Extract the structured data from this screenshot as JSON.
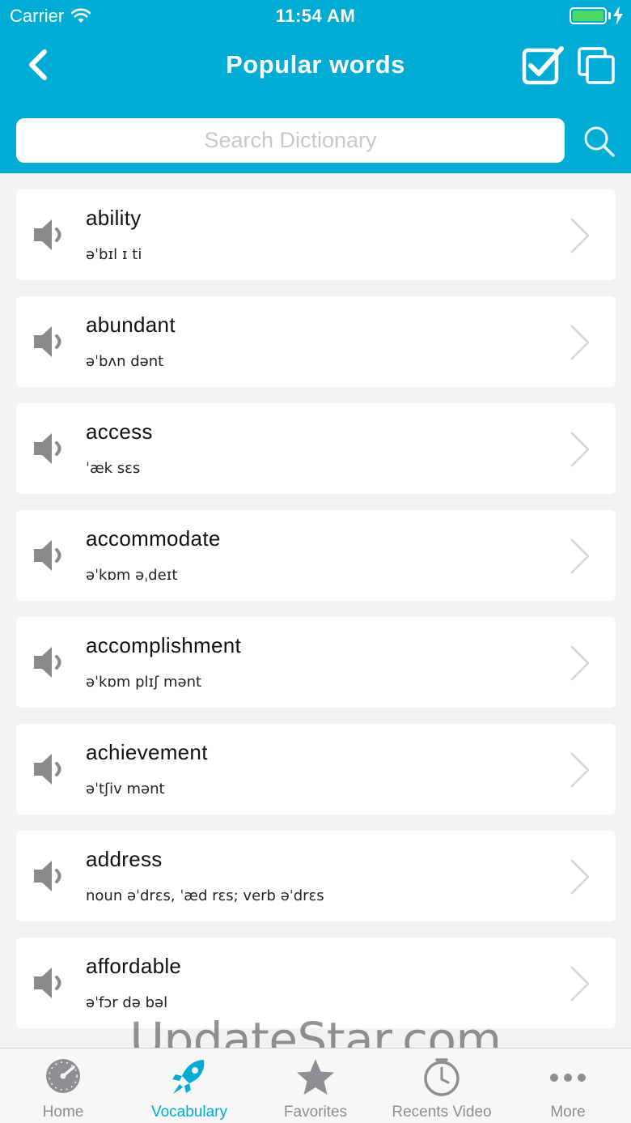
{
  "status_bar": {
    "carrier": "Carrier",
    "time": "11:54 AM"
  },
  "nav": {
    "title": "Popular words"
  },
  "search": {
    "placeholder": "Search Dictionary"
  },
  "words": [
    {
      "word": "ability",
      "phonetic": "əˈbɪl ɪ ti"
    },
    {
      "word": "abundant",
      "phonetic": "əˈbʌn dənt"
    },
    {
      "word": "access",
      "phonetic": "ˈæk sɛs"
    },
    {
      "word": "accommodate",
      "phonetic": "əˈkɒm əˌdeɪt"
    },
    {
      "word": "accomplishment",
      "phonetic": "əˈkɒm plɪʃ mənt"
    },
    {
      "word": "achievement",
      "phonetic": "əˈtʃiv mənt"
    },
    {
      "word": "address",
      "phonetic": "noun əˈdrɛs, ˈæd rɛs; verb əˈdrɛs"
    },
    {
      "word": "affordable",
      "phonetic": "əˈfɔr də bəl"
    }
  ],
  "watermark": "UpdateStar.com",
  "tabs": [
    {
      "label": "Home",
      "icon": "speedometer-icon"
    },
    {
      "label": "Vocabulary",
      "icon": "rocket-icon",
      "active": true
    },
    {
      "label": "Favorites",
      "icon": "star-icon"
    },
    {
      "label": "Recents Video",
      "icon": "clock-icon"
    },
    {
      "label": "More",
      "icon": "more-dots-icon"
    }
  ],
  "colors": {
    "accent": "#00acd4",
    "battery": "#4cd964",
    "inactive": "#8e8e93"
  }
}
